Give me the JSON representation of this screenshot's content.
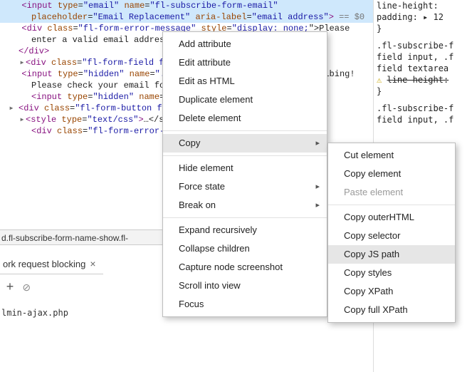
{
  "code": {
    "input_open": "<input",
    "type_attr": "type",
    "type_val": "\"email\"",
    "name_attr": "name",
    "name_val": "\"fl-subscribe-form-email\"",
    "placeholder_attr": "placeholder",
    "placeholder_val": "\"Email Replacement\"",
    "aria_attr": "aria-label",
    "aria_val": "\"email address\"",
    "input_close": ">",
    "selected_ref": " == $0",
    "div_open": "<div",
    "class_attr": "class",
    "error_class": "\"fl-form-error-message\"",
    "style_attr": "style",
    "error_style_partial": "\"display: none;\"",
    "error_text": "Please enter a valid email address.",
    "div_close": "</div>",
    "field_class": "\"fl-form-field fl-form-...\"",
    "hidden_val": "\"hidden\"",
    "thanks_partial1": "\"<p>Th",
    "thanks_text": "anks for subscribing! Please check your email for further instructions.</p>\"",
    "button_class": "\"fl-form-button fl-form-...\"",
    "button_rest": "…",
    "style_tag": "<style",
    "style_type_val": "\"text/css\"",
    "style_rest": "…</style>",
    "error_div_class": "\"fl-form-error-message\""
  },
  "breadcrumb": "d.fl-subscribe-form-name-show.fl-",
  "tab": {
    "label": "ork request blocking",
    "close": "×"
  },
  "ajax": "lmin-ajax.php",
  "styles": {
    "line1": "line-height:",
    "line2": "padding: ▸ 12",
    "brace": "}",
    "sel1": ".fl-subscribe-f",
    "sel2": "field input, .f",
    "sel3": "field textarea",
    "warn_line": "line-height:",
    "sel4": ".fl-subscribe-f",
    "sel5": "field input, .f"
  },
  "menu1": {
    "add_attr": "Add attribute",
    "edit_attr": "Edit attribute",
    "edit_html": "Edit as HTML",
    "dup": "Duplicate element",
    "del": "Delete element",
    "copy": "Copy",
    "hide": "Hide element",
    "force": "Force state",
    "break": "Break on",
    "expand": "Expand recursively",
    "collapse": "Collapse children",
    "capture": "Capture node screenshot",
    "scroll": "Scroll into view",
    "focus": "Focus"
  },
  "menu2": {
    "cut": "Cut element",
    "copy_el": "Copy element",
    "paste": "Paste element",
    "outer": "Copy outerHTML",
    "selector": "Copy selector",
    "jspath": "Copy JS path",
    "styles": "Copy styles",
    "xpath": "Copy XPath",
    "fullxpath": "Copy full XPath"
  }
}
